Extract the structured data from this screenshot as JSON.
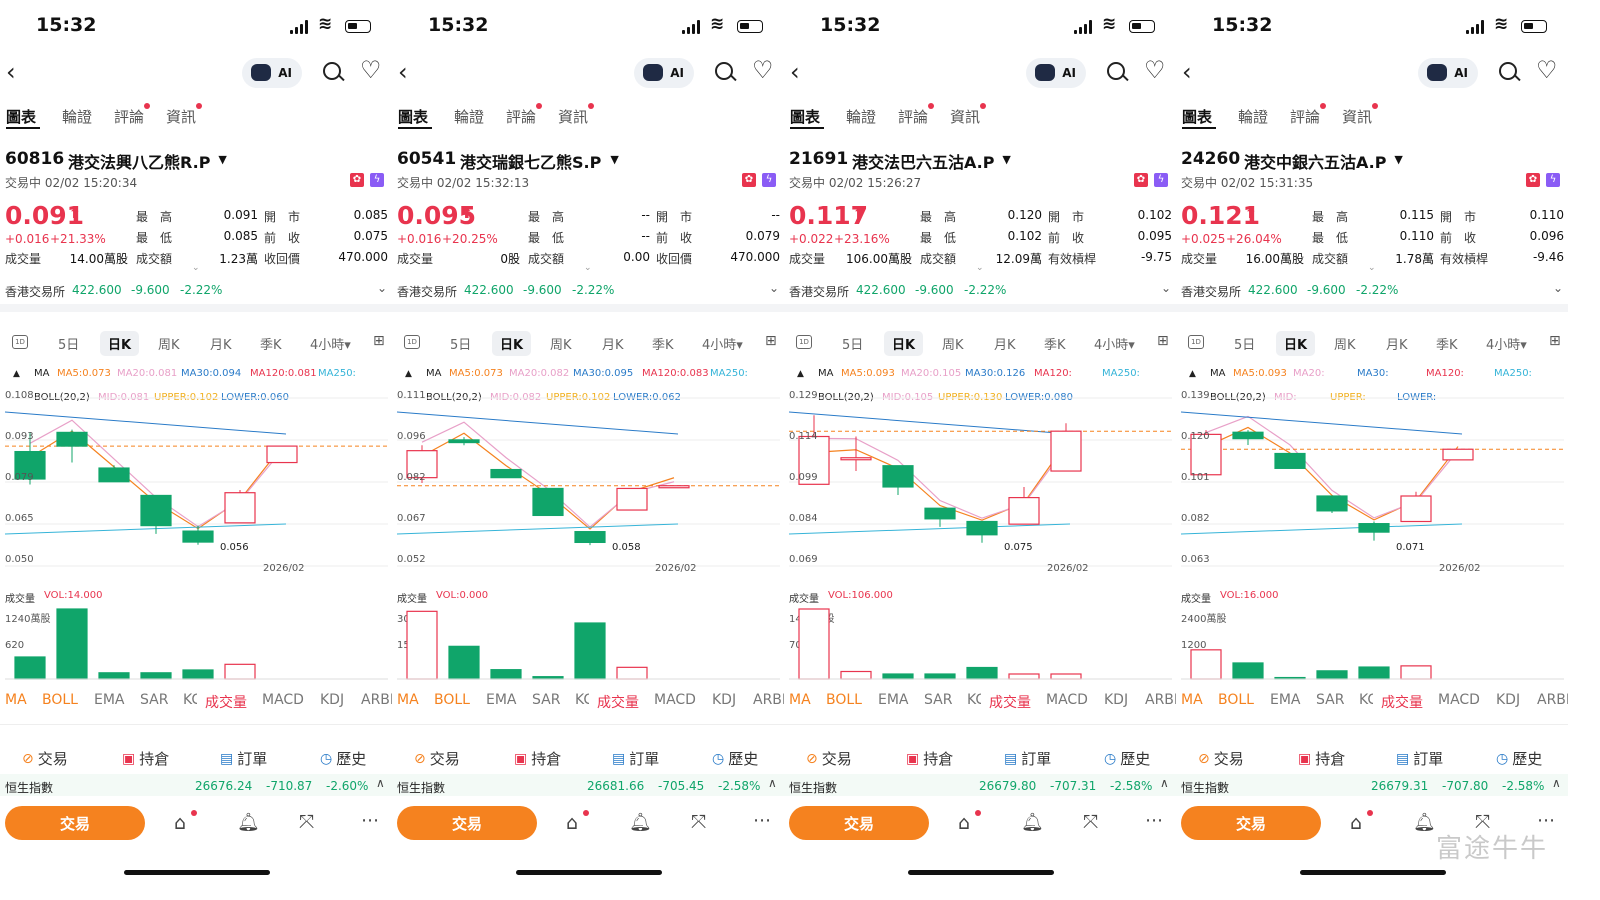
{
  "status_time": "15:32",
  "ai_label": "AI",
  "tabs": [
    "圖表",
    "輪證",
    "評論",
    "資訊"
  ],
  "labels": {
    "high": "最　高",
    "low": "最　低",
    "volume": "成交量",
    "turnover": "成交額",
    "open": "開　市",
    "prev_close": "前　收",
    "market": "香港交易所",
    "ind_ma": "MA",
    "vol_title": "成交量",
    "hsi": "恒生指數",
    "trade": "交易"
  },
  "index_bar": {
    "value": "422.600",
    "change": "-9.600",
    "pct": "-2.22%"
  },
  "kline_tabs": [
    "5日",
    "日K",
    "周K",
    "月K",
    "季K",
    "4小時▾"
  ],
  "indicators": [
    "MA",
    "BOLL",
    "EMA",
    "SAR",
    "KC",
    "成交量",
    "MACD",
    "KDJ",
    "ARBR"
  ],
  "bottom_tools": [
    "交易",
    "持倉",
    "訂單",
    "歷史"
  ],
  "date_axis": "2026/02",
  "colors": {
    "up": "#e8344e",
    "down": "#10a56a",
    "accent": "#f5821f"
  },
  "watermark": "富途牛牛",
  "panels": [
    {
      "code": "60816",
      "name": "港交法興八乙熊R.P",
      "status": "交易中 02/02 15:20:34",
      "price": "0.091",
      "change": "+0.016",
      "change_pct": "+21.33%",
      "high": "0.091",
      "low": "0.085",
      "volume": "14.00萬股",
      "turnover": "1.23萬",
      "open": "0.085",
      "prev_close": "0.075",
      "extra_label": "收回價",
      "extra_value": "470.000",
      "ma_line": [
        "MA5:0.073",
        "MA20:0.081",
        "MA30:0.094",
        "MA120:0.081",
        "MA250:"
      ],
      "boll_line": [
        "BOLL(20,2)",
        "MID:0.081",
        "UPPER:0.102",
        "LOWER:0.060"
      ],
      "y_ticks": [
        "0.108",
        "0.093",
        "0.079",
        "0.065",
        "0.050"
      ],
      "low_label": "0.056",
      "vol_label": "VOL:14.000",
      "vol_ticks": [
        "1240萬股",
        "620"
      ],
      "hsi": {
        "value": "26676.24",
        "change": "-710.87",
        "pct": "-2.60%"
      },
      "candles": [
        {
          "o": 0.089,
          "c": 0.079,
          "h": 0.096,
          "l": 0.077
        },
        {
          "o": 0.096,
          "c": 0.091,
          "h": 0.097,
          "l": 0.085
        },
        {
          "o": 0.083,
          "c": 0.078,
          "h": 0.084,
          "l": 0.078
        },
        {
          "o": 0.073,
          "c": 0.062,
          "h": 0.073,
          "l": 0.059
        },
        {
          "o": 0.06,
          "c": 0.056,
          "h": 0.062,
          "l": 0.055
        },
        {
          "o": 0.063,
          "c": 0.074,
          "h": 0.075,
          "l": 0.063
        },
        {
          "o": 0.085,
          "c": 0.091,
          "h": 0.091,
          "l": 0.085
        }
      ],
      "current": 0.091,
      "y_range": [
        0.048,
        0.11
      ],
      "volumes": [
        3.9,
        12.4,
        1.1,
        1.1,
        1.6,
        2.6,
        0
      ],
      "vol_max": 12.4
    },
    {
      "code": "60541",
      "name": "港交瑞銀七乙熊S.P",
      "status": "交易中 02/02 15:32:13",
      "price": "0.095",
      "change": "+0.016",
      "change_pct": "+20.25%",
      "high": "--",
      "low": "--",
      "volume": "0股",
      "turnover": "0.00",
      "open": "--",
      "prev_close": "0.079",
      "extra_label": "收回價",
      "extra_value": "470.000",
      "ma_line": [
        "MA5:0.073",
        "MA20:0.082",
        "MA30:0.095",
        "MA120:0.083",
        "MA250:"
      ],
      "boll_line": [
        "BOLL(20,2)",
        "MID:0.082",
        "UPPER:0.102",
        "LOWER:0.062"
      ],
      "y_ticks": [
        "0.111",
        "0.096",
        "0.082",
        "0.067",
        "0.052"
      ],
      "low_label": "0.058",
      "vol_label": "VOL:0.000",
      "vol_ticks": [
        "300萬股",
        "150"
      ],
      "hsi": {
        "value": "26681.66",
        "change": "-705.45",
        "pct": "-2.58%"
      },
      "candles": [
        {
          "o": 0.082,
          "c": 0.092,
          "h": 0.094,
          "l": 0.08
        },
        {
          "o": 0.096,
          "c": 0.095,
          "h": 0.097,
          "l": 0.094
        },
        {
          "o": 0.085,
          "c": 0.082,
          "h": 0.085,
          "l": 0.082
        },
        {
          "o": 0.078,
          "c": 0.068,
          "h": 0.078,
          "l": 0.068
        },
        {
          "o": 0.062,
          "c": 0.058,
          "h": 0.062,
          "l": 0.057
        },
        {
          "o": 0.07,
          "c": 0.078,
          "h": 0.078,
          "l": 0.07
        },
        {
          "o": 0.079,
          "c": 0.079,
          "h": 0.079,
          "l": 0.079
        }
      ],
      "current": 0.079,
      "y_range": [
        0.05,
        0.113
      ],
      "volumes": [
        2.9,
        1.4,
        0.4,
        0.1,
        2.4,
        0.5,
        0
      ],
      "vol_max": 3.0
    },
    {
      "code": "21691",
      "name": "港交法巴六五沽A.P",
      "status": "交易中 02/02 15:26:27",
      "price": "0.117",
      "change": "+0.022",
      "change_pct": "+23.16%",
      "high": "0.120",
      "low": "0.102",
      "volume": "106.00萬股",
      "turnover": "12.09萬",
      "open": "0.102",
      "prev_close": "0.095",
      "extra_label": "有效槓桿",
      "extra_value": "-9.75",
      "ma_line": [
        "MA5:0.093",
        "MA20:0.105",
        "MA30:0.126",
        "MA120:",
        "MA250:"
      ],
      "boll_line": [
        "BOLL(20,2)",
        "MID:0.105",
        "UPPER:0.130",
        "LOWER:0.080"
      ],
      "y_ticks": [
        "0.129",
        "0.114",
        "0.099",
        "0.084",
        "0.069"
      ],
      "low_label": "0.075",
      "vol_label": "VOL:106.000",
      "vol_ticks": [
        "1400萬股",
        "700"
      ],
      "hsi": {
        "value": "26679.80",
        "change": "-707.31",
        "pct": "-2.58%"
      },
      "candles": [
        {
          "o": 0.097,
          "c": 0.115,
          "h": 0.123,
          "l": 0.097
        },
        {
          "o": 0.107,
          "c": 0.107,
          "h": 0.115,
          "l": 0.102
        },
        {
          "o": 0.104,
          "c": 0.096,
          "h": 0.104,
          "l": 0.093
        },
        {
          "o": 0.088,
          "c": 0.084,
          "h": 0.088,
          "l": 0.081
        },
        {
          "o": 0.083,
          "c": 0.078,
          "h": 0.083,
          "l": 0.075
        },
        {
          "o": 0.082,
          "c": 0.092,
          "h": 0.096,
          "l": 0.082
        },
        {
          "o": 0.102,
          "c": 0.117,
          "h": 0.12,
          "l": 0.102
        }
      ],
      "current": 0.117,
      "y_range": [
        0.067,
        0.131
      ],
      "volumes": [
        14.0,
        1.5,
        1.0,
        1.0,
        2.3,
        1.0,
        1.0
      ],
      "vol_max": 14.0
    },
    {
      "code": "24260",
      "name": "港交中銀六五沽A.P",
      "status": "交易中 02/02 15:31:35",
      "price": "0.121",
      "change": "+0.025",
      "change_pct": "+26.04%",
      "high": "0.115",
      "low": "0.110",
      "volume": "16.00萬股",
      "turnover": "1.78萬",
      "open": "0.110",
      "prev_close": "0.096",
      "extra_label": "有效槓桿",
      "extra_value": "-9.46",
      "ma_line": [
        "MA5:0.093",
        "MA20:",
        "MA30:",
        "MA120:",
        "MA250:"
      ],
      "boll_line": [
        "BOLL(20,2)",
        "MID:",
        "UPPER:",
        "LOWER:"
      ],
      "y_ticks": [
        "0.139",
        "0.120",
        "0.101",
        "0.082",
        "0.063"
      ],
      "low_label": "0.071",
      "vol_label": "VOL:16.000",
      "vol_ticks": [
        "2400萬股",
        "1200"
      ],
      "hsi": {
        "value": "26679.31",
        "change": "-707.80",
        "pct": "-2.58%"
      },
      "candles": [
        {
          "o": 0.103,
          "c": 0.122,
          "h": 0.124,
          "l": 0.103
        },
        {
          "o": 0.123,
          "c": 0.12,
          "h": 0.124,
          "l": 0.117
        },
        {
          "o": 0.113,
          "c": 0.106,
          "h": 0.113,
          "l": 0.106
        },
        {
          "o": 0.093,
          "c": 0.086,
          "h": 0.093,
          "l": 0.085
        },
        {
          "o": 0.08,
          "c": 0.076,
          "h": 0.081,
          "l": 0.072
        },
        {
          "o": 0.081,
          "c": 0.093,
          "h": 0.095,
          "l": 0.081
        },
        {
          "o": 0.11,
          "c": 0.115,
          "h": 0.115,
          "l": 0.11
        }
      ],
      "current": 0.115,
      "y_range": [
        0.061,
        0.141
      ],
      "volumes": [
        10.0,
        5.5,
        0.5,
        2.8,
        4.1,
        4.5,
        0
      ],
      "vol_max": 24.0
    }
  ]
}
